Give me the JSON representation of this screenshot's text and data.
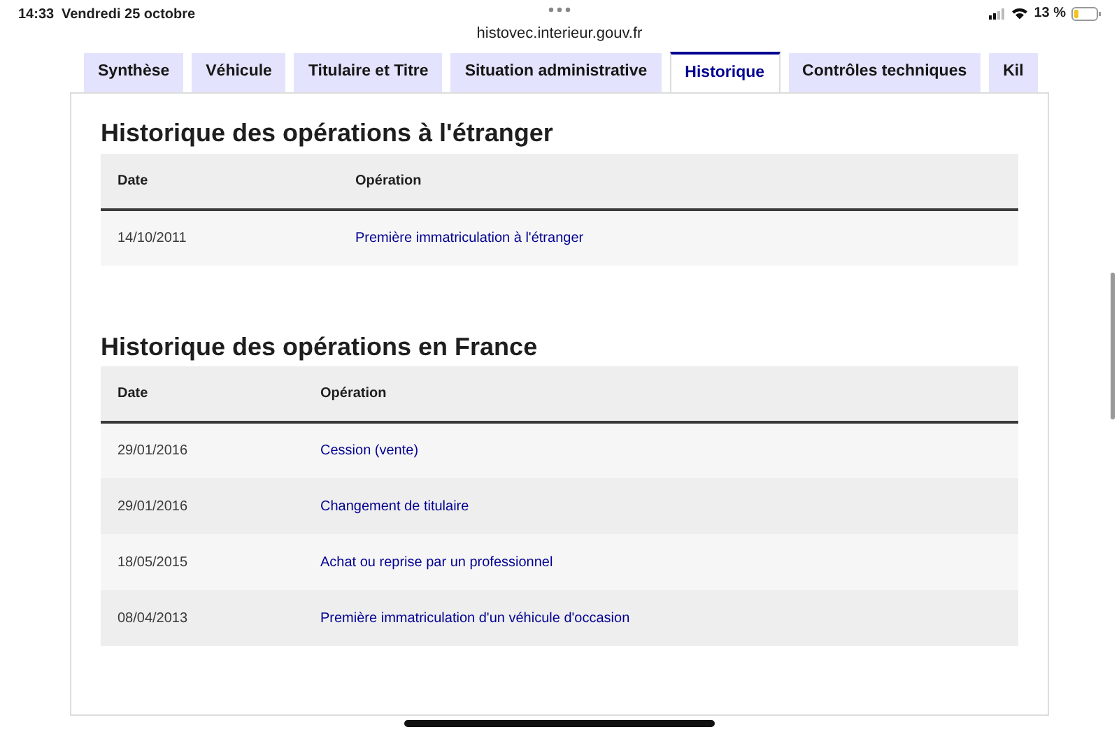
{
  "status_bar": {
    "time": "14:33",
    "date": "Vendredi 25 octobre",
    "url": "histovec.interieur.gouv.fr",
    "battery": "13 %"
  },
  "tabs": [
    {
      "label": "Synthèse",
      "selected": false
    },
    {
      "label": "Véhicule",
      "selected": false
    },
    {
      "label": "Titulaire et Titre",
      "selected": false
    },
    {
      "label": "Situation administrative",
      "selected": false
    },
    {
      "label": "Historique",
      "selected": true
    },
    {
      "label": "Contrôles techniques",
      "selected": false
    },
    {
      "label": "Kil",
      "selected": false
    }
  ],
  "sections": [
    {
      "title": "Historique des opérations à l'étranger",
      "columns": [
        "Date",
        "Opération"
      ],
      "rows": [
        {
          "date": "14/10/2011",
          "operation": "Première immatriculation à l'étranger"
        }
      ]
    },
    {
      "title": "Historique des opérations en France",
      "columns": [
        "Date",
        "Opération"
      ],
      "rows": [
        {
          "date": "29/01/2016",
          "operation": "Cession (vente)"
        },
        {
          "date": "29/01/2016",
          "operation": "Changement de titulaire"
        },
        {
          "date": "18/05/2015",
          "operation": "Achat ou reprise par un professionnel"
        },
        {
          "date": "08/04/2013",
          "operation": "Première immatriculation d'un véhicule d'occasion"
        }
      ]
    }
  ]
}
